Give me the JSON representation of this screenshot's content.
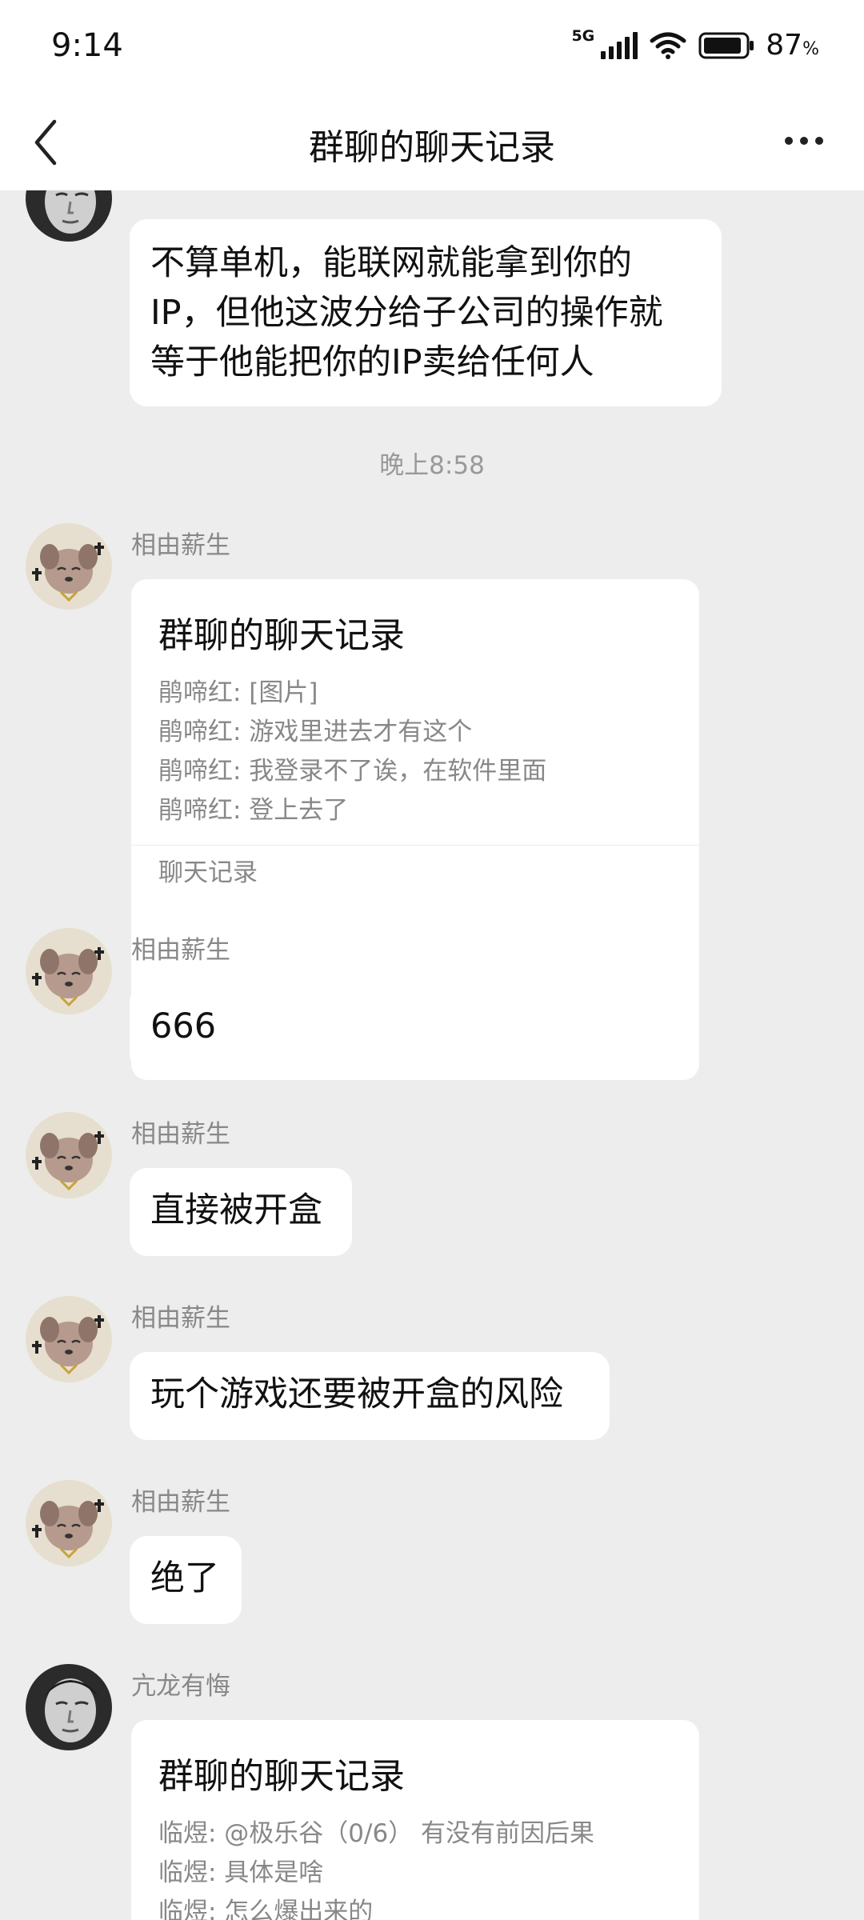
{
  "status_bar": {
    "time": "9:14",
    "network": "5G",
    "battery_percent": "87",
    "battery_unit": "%"
  },
  "nav": {
    "title": "群聊的聊天记录",
    "back_icon": "chevron-left-icon",
    "more_icon": "more-dots-icon"
  },
  "messages": {
    "m1": {
      "text_lines": [
        "不算单机，能联网就能拿到你的",
        "IP，但他这波分给子公司的操作就",
        "等于他能把你的IP卖给任何人"
      ]
    },
    "timestamp": "晚上8:58",
    "m2": {
      "sender": "相由薪生",
      "card_title": "群聊的聊天记录",
      "card_lines": [
        "鹃啼红: [图片]",
        "鹃啼红: 游戏里进去才有这个",
        "鹃啼红: 我登录不了诶，在软件里面",
        "鹃啼红: 登上去了"
      ],
      "card_footer": "聊天记录"
    },
    "m3": {
      "sender": "相由薪生",
      "text": "666"
    },
    "m4": {
      "sender": "相由薪生",
      "text": "直接被开盒"
    },
    "m5": {
      "sender": "相由薪生",
      "text": "玩个游戏还要被开盒的风险"
    },
    "m6": {
      "sender": "相由薪生",
      "text": "绝了"
    },
    "m7": {
      "sender": "亢龙有悔",
      "card_title": "群聊的聊天记录",
      "card_lines": [
        "临煜: @极乐谷（0/6） 有没有前因后果",
        "临煜: 具体是啥",
        "临煜: 怎么爆出来的"
      ]
    }
  },
  "colors": {
    "background": "#ededed",
    "bubble": "#ffffff",
    "meta_text": "#888888"
  }
}
